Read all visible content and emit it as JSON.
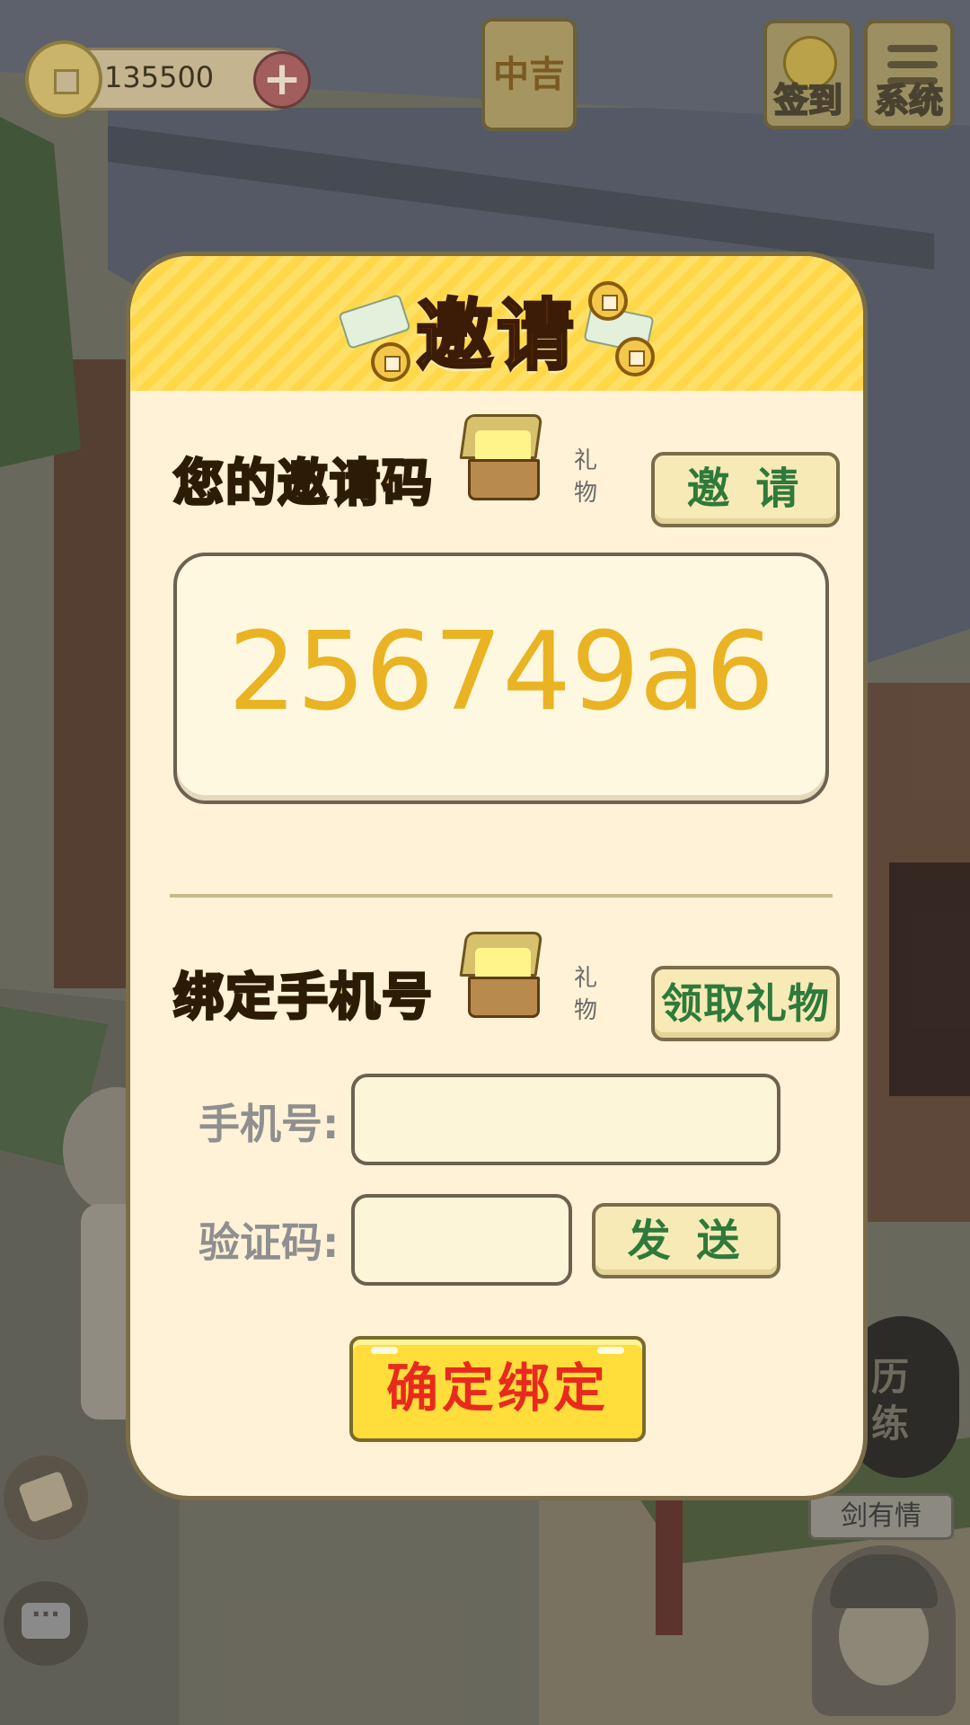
{
  "hud": {
    "coins": "135500",
    "luck_label": "中吉",
    "signin_label": "签到",
    "system_label": "系统"
  },
  "side": {
    "train_label": "历练",
    "player_name": "剑有情"
  },
  "modal": {
    "title": "邀请",
    "invite": {
      "section_title": "您的邀请码",
      "gift_label": "礼物",
      "button_label": "邀 请",
      "code": "256749a6"
    },
    "bind": {
      "section_title": "绑定手机号",
      "gift_label": "礼物",
      "claim_button_label": "领取礼物",
      "phone_label": "手机号:",
      "phone_value": "",
      "code_label": "验证码:",
      "code_value": "",
      "send_button_label": "发 送",
      "confirm_button_label": "确定绑定"
    }
  },
  "icons": {
    "coin": "coin-icon",
    "plus": "plus-icon",
    "signin": "signin-coins-icon",
    "system": "menu-icon",
    "chest": "treasure-chest-icon",
    "scroll": "scroll-icon",
    "chat": "chat-bubble-icon"
  },
  "colors": {
    "modal_bg": "#fff2d6",
    "header_stripes": "#ffe066",
    "section_title": "#f8c21e",
    "invite_code": "#e9b323",
    "green_text": "#2f7a3a",
    "confirm_bg": "#ffdd3a",
    "confirm_text": "#e82a1e"
  }
}
